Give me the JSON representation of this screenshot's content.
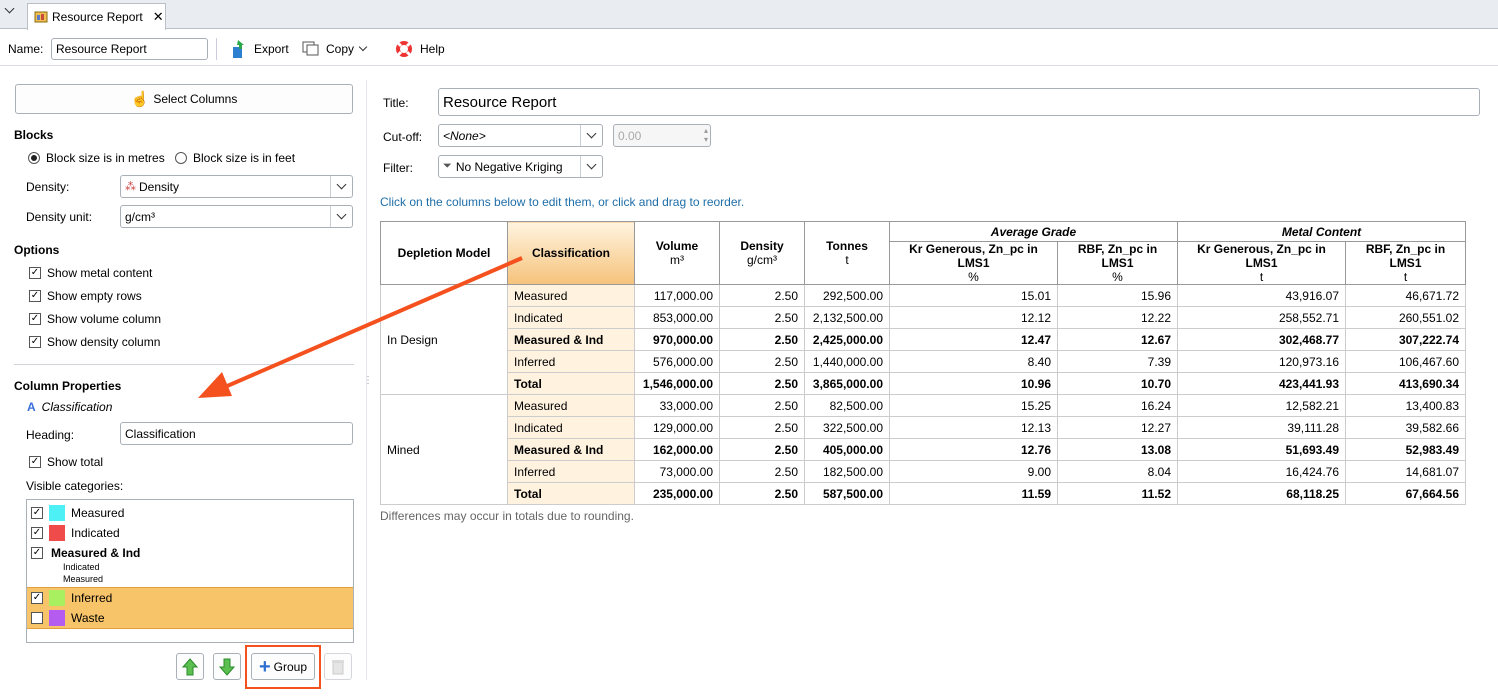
{
  "tab": {
    "title": "Resource Report"
  },
  "toolbar": {
    "name_label": "Name:",
    "name_value": "Resource Report",
    "export": "Export",
    "copy": "Copy",
    "help": "Help"
  },
  "left": {
    "select_columns": "Select Columns",
    "blocks": {
      "title": "Blocks",
      "opt_metres": "Block size is in metres",
      "opt_feet": "Block size is in feet",
      "density_label": "Density:",
      "density_value": "Density",
      "unit_label": "Density unit:",
      "unit_value": "g/cm³"
    },
    "options": {
      "title": "Options",
      "items": [
        "Show metal content",
        "Show empty rows",
        "Show volume column",
        "Show density column"
      ]
    },
    "colprops": {
      "title": "Column Properties",
      "column": "Classification",
      "heading_label": "Heading:",
      "heading_value": "Classification",
      "show_total": "Show total",
      "visible_label": "Visible categories:"
    },
    "categories": [
      {
        "name": "Measured",
        "color": "#4df0f5",
        "checked": true
      },
      {
        "name": "Indicated",
        "color": "#f04b4b",
        "checked": true
      },
      {
        "name": "Measured & Ind",
        "checked": true,
        "subs": [
          "Indicated",
          "Measured"
        ]
      },
      {
        "name": "Inferred",
        "color": "#a8f060",
        "checked": true
      },
      {
        "name": "Waste",
        "color": "#b45cf0",
        "checked": false
      }
    ],
    "group_button": "Group"
  },
  "right": {
    "title_label": "Title:",
    "title_value": "Resource Report",
    "cutoff_label": "Cut-off:",
    "cutoff_value": "<None>",
    "cutoff_number": "0.00",
    "filter_label": "Filter:",
    "filter_value": "No Negative Kriging",
    "hint": "Click on the columns below to edit them, or click and drag to reorder.",
    "footnote": "Differences may occur in totals due to rounding."
  },
  "table": {
    "group_headers": {
      "avg": "Average Grade",
      "metal": "Metal Content"
    },
    "headers": [
      {
        "label": "Depletion Model",
        "unit": ""
      },
      {
        "label": "Classification",
        "unit": ""
      },
      {
        "label": "Volume",
        "unit": "m³"
      },
      {
        "label": "Density",
        "unit": "g/cm³"
      },
      {
        "label": "Tonnes",
        "unit": "t"
      },
      {
        "label": "Kr Generous, Zn_pc in LMS1",
        "unit": "%"
      },
      {
        "label": "RBF, Zn_pc in LMS1",
        "unit": "%"
      },
      {
        "label": "Kr Generous, Zn_pc in LMS1",
        "unit": "t"
      },
      {
        "label": "RBF, Zn_pc in LMS1",
        "unit": "t"
      }
    ],
    "groups": [
      {
        "name": "In Design",
        "rows": [
          {
            "c": "Measured",
            "v": [
              "117,000.00",
              "2.50",
              "292,500.00",
              "15.01",
              "15.96",
              "43,916.07",
              "46,671.72"
            ],
            "bold": false
          },
          {
            "c": "Indicated",
            "v": [
              "853,000.00",
              "2.50",
              "2,132,500.00",
              "12.12",
              "12.22",
              "258,552.71",
              "260,551.02"
            ],
            "bold": false
          },
          {
            "c": "Measured & Ind",
            "v": [
              "970,000.00",
              "2.50",
              "2,425,000.00",
              "12.47",
              "12.67",
              "302,468.77",
              "307,222.74"
            ],
            "bold": true
          },
          {
            "c": "Inferred",
            "v": [
              "576,000.00",
              "2.50",
              "1,440,000.00",
              "8.40",
              "7.39",
              "120,973.16",
              "106,467.60"
            ],
            "bold": false
          },
          {
            "c": "Total",
            "v": [
              "1,546,000.00",
              "2.50",
              "3,865,000.00",
              "10.96",
              "10.70",
              "423,441.93",
              "413,690.34"
            ],
            "bold": true
          }
        ]
      },
      {
        "name": "Mined",
        "rows": [
          {
            "c": "Measured",
            "v": [
              "33,000.00",
              "2.50",
              "82,500.00",
              "15.25",
              "16.24",
              "12,582.21",
              "13,400.83"
            ],
            "bold": false
          },
          {
            "c": "Indicated",
            "v": [
              "129,000.00",
              "2.50",
              "322,500.00",
              "12.13",
              "12.27",
              "39,111.28",
              "39,582.66"
            ],
            "bold": false
          },
          {
            "c": "Measured & Ind",
            "v": [
              "162,000.00",
              "2.50",
              "405,000.00",
              "12.76",
              "13.08",
              "51,693.49",
              "52,983.49"
            ],
            "bold": true
          },
          {
            "c": "Inferred",
            "v": [
              "73,000.00",
              "2.50",
              "182,500.00",
              "9.00",
              "8.04",
              "16,424.76",
              "14,681.07"
            ],
            "bold": false
          },
          {
            "c": "Total",
            "v": [
              "235,000.00",
              "2.50",
              "587,500.00",
              "11.59",
              "11.52",
              "68,118.25",
              "67,664.56"
            ],
            "bold": true
          }
        ]
      }
    ]
  },
  "colors": {
    "accent": "#f4511e",
    "selected_row": "#f7c46a",
    "classification_col": "#f5c27a"
  }
}
